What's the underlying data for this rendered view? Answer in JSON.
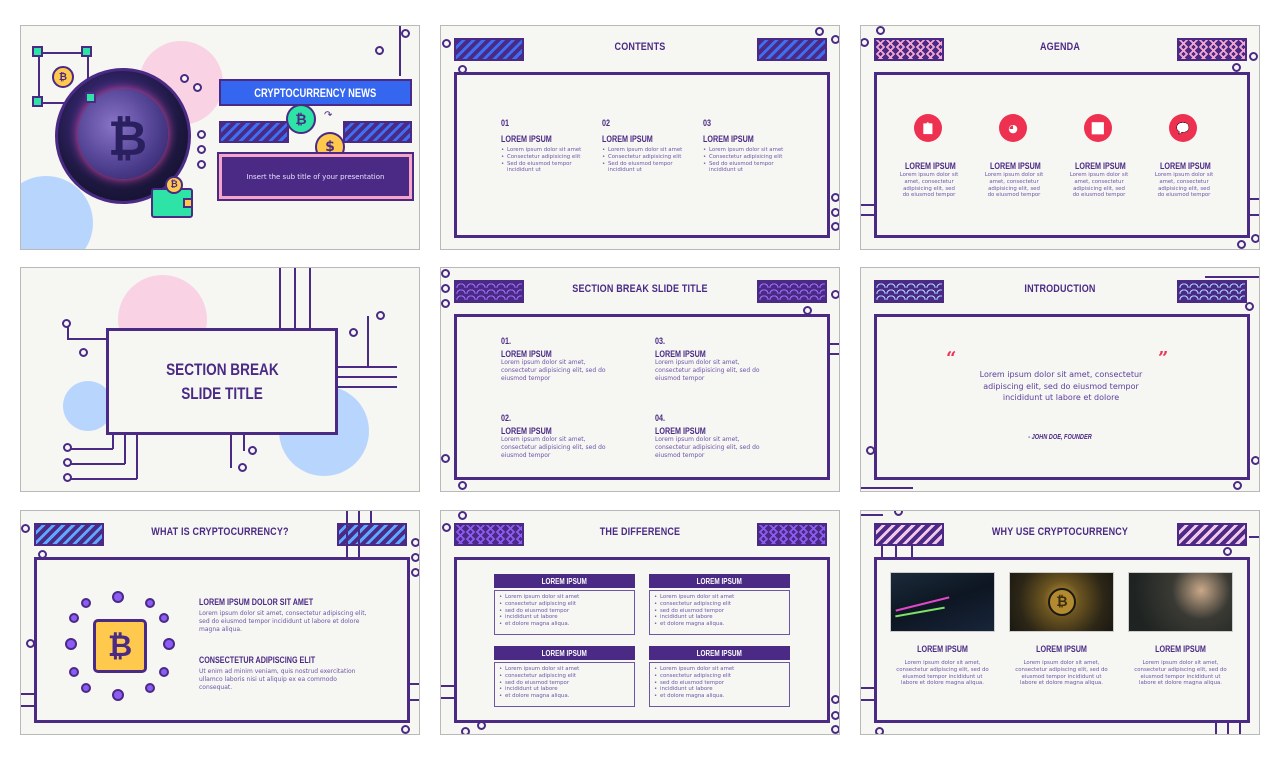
{
  "colors": {
    "primary": "#4a2a85",
    "accent_blue": "#3d6ff2",
    "accent_red": "#ee3150",
    "pink": "#f7c9dd",
    "light_blue": "#b8d6fd",
    "background": "#f6f6f3"
  },
  "slides": [
    {
      "id": 1,
      "title": "CRYPTOCURRENCY NEWS",
      "subtitle": "Insert the sub title of your presentation",
      "icons": [
        "bitcoin-icon",
        "dollar-icon",
        "wallet-icon",
        "exchange-arrows-icon"
      ]
    },
    {
      "id": 2,
      "title": "CONTENTS",
      "columns": [
        {
          "num": "01",
          "heading": "LOREM IPSUM",
          "bullets": [
            "Lorem ipsum dolor sit amet",
            "Consectetur adipisicing elit",
            "Sed do eiusmod tempor incididunt ut"
          ]
        },
        {
          "num": "02",
          "heading": "LOREM IPSUM",
          "bullets": [
            "Lorem ipsum dolor sit amet",
            "Consectetur adipisicing elit",
            "Sed do eiusmod tempor incididunt ut"
          ]
        },
        {
          "num": "03",
          "heading": "LOREM IPSUM",
          "bullets": [
            "Lorem ipsum dolor sit amet",
            "Consectetur adipisicing elit",
            "Sed do eiusmod tempor incididunt ut"
          ]
        }
      ]
    },
    {
      "id": 3,
      "title": "AGENDA",
      "items": [
        {
          "icon": "clipboard-icon",
          "glyph": "📋",
          "heading": "LOREM IPSUM",
          "text": "Lorem ipsum dolor sit amet, consectetur adipisicing elit, sed do eiusmod tempor"
        },
        {
          "icon": "pie-chart-icon",
          "glyph": "◕",
          "heading": "LOREM IPSUM",
          "text": "Lorem ipsum dolor sit amet, consectetur adipisicing elit, sed do eiusmod tempor"
        },
        {
          "icon": "bar-chart-icon",
          "glyph": "📊",
          "heading": "LOREM IPSUM",
          "text": "Lorem ipsum dolor sit amet, consectetur adipisicing elit, sed do eiusmod tempor"
        },
        {
          "icon": "chat-icon",
          "glyph": "💬",
          "heading": "LOREM IPSUM",
          "text": "Lorem ipsum dolor sit amet, consectetur adipisicing elit, sed do eiusmod tempor"
        }
      ]
    },
    {
      "id": 4,
      "title_line1": "SECTION BREAK",
      "title_line2": "SLIDE TITLE"
    },
    {
      "id": 5,
      "title": "SECTION BREAK SLIDE TITLE",
      "items": [
        {
          "num": "01.",
          "heading": "LOREM IPSUM",
          "text": "Lorem ipsum dolor sit amet, consectetur adipisicing elit, sed do eiusmod tempor"
        },
        {
          "num": "02.",
          "heading": "LOREM IPSUM",
          "text": "Lorem ipsum dolor sit amet, consectetur adipisicing elit, sed do eiusmod tempor"
        },
        {
          "num": "03.",
          "heading": "LOREM IPSUM",
          "text": "Lorem ipsum dolor sit amet, consectetur adipisicing elit, sed do eiusmod tempor"
        },
        {
          "num": "04.",
          "heading": "LOREM IPSUM",
          "text": "Lorem ipsum dolor sit amet, consectetur adipisicing elit, sed do eiusmod tempor"
        }
      ]
    },
    {
      "id": 6,
      "title": "INTRODUCTION",
      "open_quote": "“",
      "close_quote": "”",
      "quote": "Lorem ipsum dolor sit amet, consectetur adipiscing elit, sed do eiusmod tempor incididunt ut labore et dolore",
      "author": "- JOHN DOE, FOUNDER"
    },
    {
      "id": 7,
      "title": "WHAT IS CRYPTOCURRENCY?",
      "sections": [
        {
          "heading": "LOREM IPSUM DOLOR SIT AMET",
          "text": "Lorem ipsum dolor sit amet, consectetur adipiscing elit, sed do eiusmod tempor incididunt ut labore et dolore magna aliqua."
        },
        {
          "heading": "CONSECTETUR ADIPISCING ELIT",
          "text": "Ut enim ad minim veniam, quis nostrud exercitation ullamco laboris nisi ut aliquip ex ea commodo consequat."
        }
      ]
    },
    {
      "id": 8,
      "title": "THE DIFFERENCE",
      "boxes": [
        {
          "heading": "LOREM IPSUM",
          "bullets": [
            "Lorem ipsum dolor sit amet",
            "consectetur adipiscing elit",
            "sed do eiusmod tempor",
            "incididunt ut labore",
            "et dolore magna aliqua."
          ]
        },
        {
          "heading": "LOREM IPSUM",
          "bullets": [
            "Lorem ipsum dolor sit amet",
            "consectetur adipiscing elit",
            "sed do eiusmod tempor",
            "incididunt ut labore",
            "et dolore magna aliqua."
          ]
        },
        {
          "heading": "LOREM IPSUM",
          "bullets": [
            "Lorem ipsum dolor sit amet",
            "consectetur adipiscing elit",
            "sed do eiusmod tempor",
            "incididunt ut labore",
            "et dolore magna aliqua."
          ]
        },
        {
          "heading": "LOREM IPSUM",
          "bullets": [
            "Lorem ipsum dolor sit amet",
            "consectetur adipiscing elit",
            "sed do eiusmod tempor",
            "incididunt ut labore",
            "et dolore magna aliqua."
          ]
        }
      ]
    },
    {
      "id": 9,
      "title": "WHY USE CRYPTOCURRENCY",
      "cards": [
        {
          "image": "stock-chart-photo",
          "heading": "LOREM IPSUM",
          "text": "Lorem ipsum dolor sit amet, consectetur adipiscing elit, sed do eiusmod tempor incididunt ut labore et dolore magna aliqua."
        },
        {
          "image": "bitcoin-chip-photo",
          "heading": "LOREM IPSUM",
          "text": "Lorem ipsum dolor sit amet, consectetur adipiscing elit, sed do eiusmod tempor incididunt ut labore et dolore magna aliqua."
        },
        {
          "image": "network-touch-photo",
          "heading": "LOREM IPSUM",
          "text": "Lorem ipsum dolor sit amet, consectetur adipiscing elit, sed do eiusmod tempor incididunt ut labore et dolore magna aliqua."
        }
      ]
    }
  ]
}
